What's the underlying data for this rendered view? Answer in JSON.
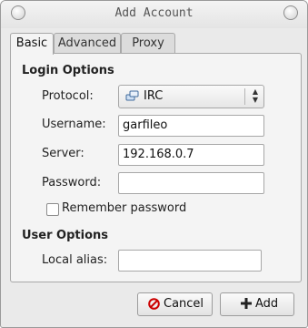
{
  "window": {
    "title": "Add Account"
  },
  "tabs": [
    {
      "label": "Basic",
      "active": true
    },
    {
      "label": "Advanced",
      "active": false
    },
    {
      "label": "Proxy",
      "active": false
    }
  ],
  "login_options": {
    "heading": "Login Options",
    "protocol": {
      "label": "Protocol:",
      "value": "IRC",
      "icon": "irc-protocol-icon"
    },
    "username": {
      "label": "Username:",
      "value": "garfileo"
    },
    "server": {
      "label": "Server:",
      "value": "192.168.0.7"
    },
    "password": {
      "label": "Password:",
      "value": ""
    },
    "remember_password": {
      "label": "Remember password",
      "checked": false
    }
  },
  "user_options": {
    "heading": "User Options",
    "local_alias": {
      "label": "Local alias:",
      "value": ""
    }
  },
  "buttons": {
    "cancel": {
      "label": "Cancel",
      "icon": "cancel-icon",
      "icon_color": "#cc0000"
    },
    "add": {
      "label": "Add",
      "icon": "plus-icon"
    }
  }
}
